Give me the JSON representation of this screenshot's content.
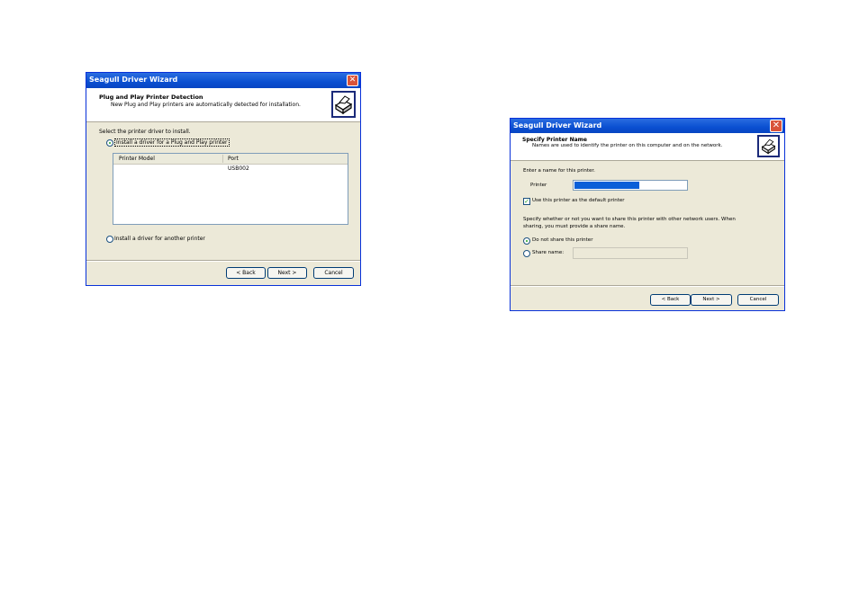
{
  "dialog1": {
    "title": "Seagull Driver Wizard",
    "header_title": "Plug and Play Printer Detection",
    "header_subtitle": "New Plug and Play printers are automatically detected for installation.",
    "prompt": "Select the printer driver to install.",
    "option_pnp": "Install a driver for a Plug and Play printer",
    "option_pnp_selected": true,
    "table": {
      "columns": [
        "Printer Model",
        "Port"
      ],
      "rows": [
        [
          "",
          "USB002"
        ]
      ]
    },
    "option_other": "Install a driver for another printer",
    "back_label": "< Back",
    "next_label": "Next >",
    "cancel_label": "Cancel"
  },
  "dialog2": {
    "title": "Seagull Driver Wizard",
    "header_title": "Specify Printer Name",
    "header_subtitle": "Names are used to identify the printer on this computer and on the network.",
    "name_prompt": "Enter a name for this printer.",
    "printer_label": "Printer",
    "printer_value": "",
    "default_checkbox_label": "Use this printer as the default printer",
    "default_checked": true,
    "share_text_line1": "Specify whether or not you want to share this printer with other network users.  When",
    "share_text_line2": "sharing, you must provide a share name.",
    "no_share_label": "Do not share this printer",
    "share_name_label": "Share name:",
    "share_name_value": "",
    "back_label": "< Back",
    "next_label": "Next >",
    "cancel_label": "Cancel"
  },
  "colors": {
    "titlebar": "#0a4fd1",
    "selection": "#0a5fd8",
    "close": "#d9533a",
    "dialog_bg": "#ece9d8"
  },
  "icons": {
    "header_icon": "printer-icon",
    "close_icon": "close-x-icon"
  }
}
